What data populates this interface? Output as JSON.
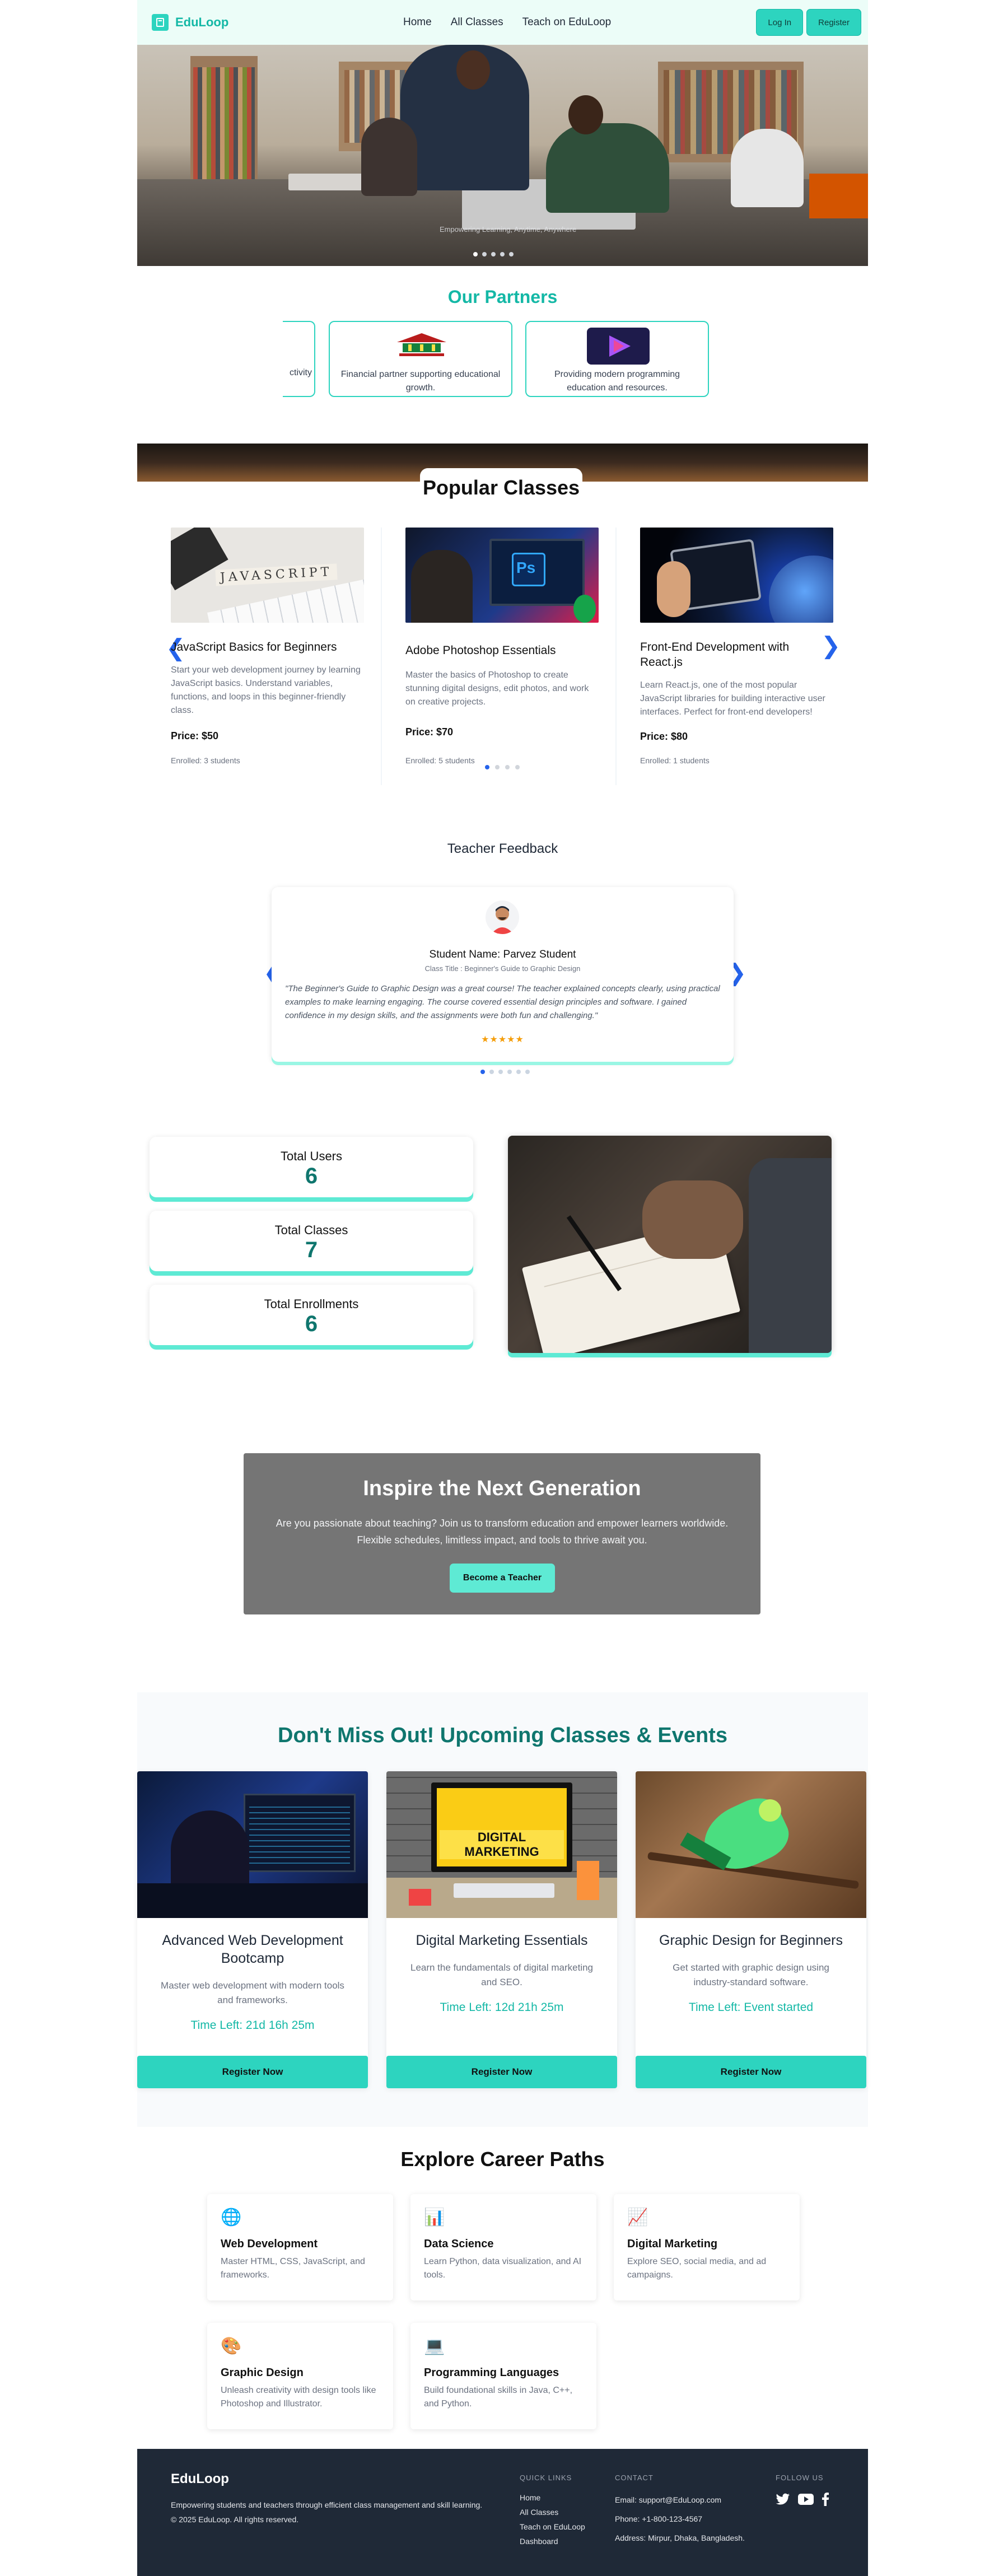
{
  "nav": {
    "brand": "EduLoop",
    "links": [
      "Home",
      "All Classes",
      "Teach on EduLoop"
    ],
    "login": "Log In",
    "register": "Register"
  },
  "hero": {
    "caption": "Empowering Learning, Anytime, Anywhere"
  },
  "partners": {
    "title": "Our Partners",
    "items": [
      {
        "text": "ctivity"
      },
      {
        "text": "Financial partner supporting educational growth."
      },
      {
        "text": "Providing modern programming education and resources."
      }
    ]
  },
  "popular": {
    "title": "Popular Classes",
    "cards": [
      {
        "title": "JavaScript Basics for Beginners",
        "desc": "Start your web development journey by learning JavaScript basics. Understand variables, functions, and loops in this beginner-friendly class.",
        "price": "Price: $50",
        "enrolled": "Enrolled: 3 students",
        "image_text": "JAVASCRIPT"
      },
      {
        "title": "Adobe Photoshop Essentials",
        "desc": "Master the basics of Photoshop to create stunning digital designs, edit photos, and work on creative projects.",
        "price": "Price: $70",
        "enrolled": "Enrolled: 5 students",
        "image_text": "Ps"
      },
      {
        "title": "Front-End Development with React.js",
        "desc": "Learn React.js, one of the most popular JavaScript libraries for building interactive user interfaces. Perfect for front-end developers!",
        "price": "Price: $80",
        "enrolled": "Enrolled: 1 students"
      }
    ]
  },
  "feedback": {
    "title": "Teacher Feedback",
    "student": "Student Name: Parvez Student",
    "class_title": "Class Title : Beginner's Guide to Graphic Design",
    "quote": "\"The Beginner's Guide to Graphic Design was a great course! The teacher explained concepts clearly, using practical examples to make learning engaging. The course covered essential design principles and software. I gained confidence in my design skills, and the assignments were both fun and challenging.\"",
    "stars": "★★★★★",
    "rating": 5
  },
  "stats": [
    {
      "label": "Total Users",
      "value": "6"
    },
    {
      "label": "Total Classes",
      "value": "7"
    },
    {
      "label": "Total Enrollments",
      "value": "6"
    }
  ],
  "inspire": {
    "title": "Inspire the Next Generation",
    "text": "Are you passionate about teaching? Join us to transform education and empower learners worldwide. Flexible schedules, limitless impact, and tools to thrive await you.",
    "button": "Become a Teacher"
  },
  "events": {
    "title": "Don't Miss Out! Upcoming Classes & Events",
    "cards": [
      {
        "title": "Advanced Web Development Bootcamp",
        "desc": "Master web development with modern tools and frameworks.",
        "time": "Time Left: 21d 16h 25m",
        "button": "Register Now"
      },
      {
        "title": "Digital Marketing Essentials",
        "desc": "Learn the fundamentals of digital marketing and SEO.",
        "time": "Time Left: 12d 21h 25m",
        "button": "Register Now",
        "image_text": "DIGITAL MARKETING"
      },
      {
        "title": "Graphic Design for Beginners",
        "desc": "Get started with graphic design using industry-standard software.",
        "time": "Time Left: Event started",
        "button": "Register Now"
      }
    ]
  },
  "careers": {
    "title": "Explore Career Paths",
    "items": [
      {
        "icon": "globe-icon",
        "glyph": "🌐",
        "title": "Web Development",
        "desc": "Master HTML, CSS, JavaScript, and frameworks."
      },
      {
        "icon": "bar-chart-icon",
        "glyph": "📊",
        "title": "Data Science",
        "desc": "Learn Python, data visualization, and AI tools."
      },
      {
        "icon": "trend-chart-icon",
        "glyph": "📈",
        "title": "Digital Marketing",
        "desc": "Explore SEO, social media, and ad campaigns."
      },
      {
        "icon": "palette-icon",
        "glyph": "🎨",
        "title": "Graphic Design",
        "desc": "Unleash creativity with design tools like Photoshop and Illustrator."
      },
      {
        "icon": "laptop-icon",
        "glyph": "💻",
        "title": "Programming Languages",
        "desc": "Build foundational skills in Java, C++, and Python."
      }
    ]
  },
  "footer": {
    "brand": "EduLoop",
    "tagline": "Empowering students and teachers through efficient class management and skill learning.",
    "copyright": "© 2025 EduLoop. All rights reserved.",
    "quick_title": "QUICK LINKS",
    "quick_links": [
      "Home",
      "All Classes",
      "Teach on EduLoop",
      "Dashboard"
    ],
    "contact_title": "CONTACT",
    "email": "Email: support@EduLoop.com",
    "phone": "Phone: +1-800-123-4567",
    "address": "Address: Mirpur, Dhaka, Bangladesh.",
    "follow_title": "FOLLOW US"
  },
  "colors": {
    "accent": "#2dd4bf",
    "accent_dark": "#14b8a6",
    "footer_bg": "#1f2937",
    "inspire_bg": "#757575"
  }
}
